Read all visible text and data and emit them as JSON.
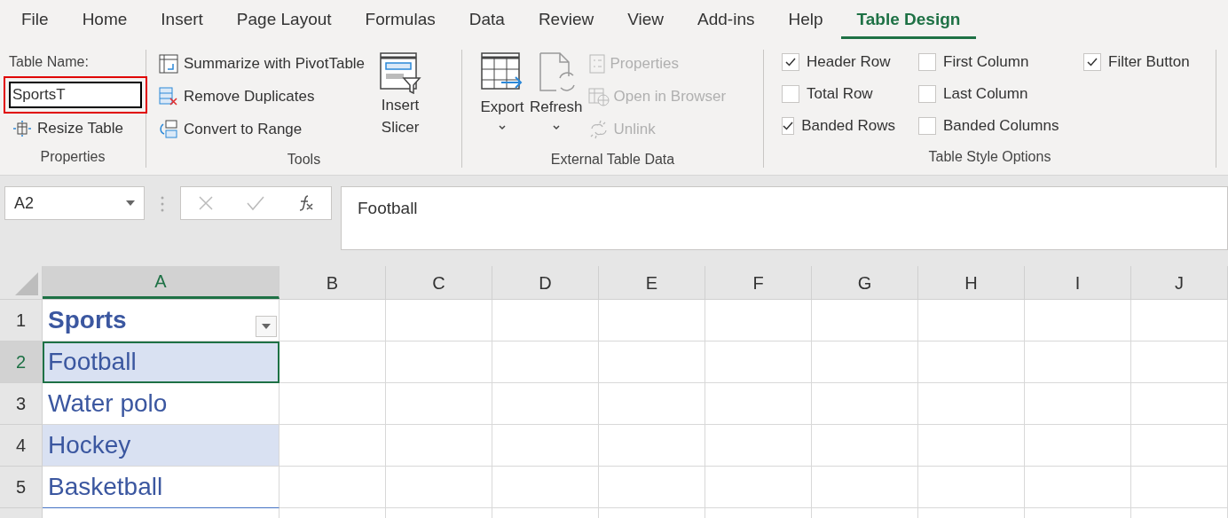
{
  "menu_tabs": [
    {
      "label": "File",
      "selected": false
    },
    {
      "label": "Home",
      "selected": false
    },
    {
      "label": "Insert",
      "selected": false
    },
    {
      "label": "Page Layout",
      "selected": false
    },
    {
      "label": "Formulas",
      "selected": false
    },
    {
      "label": "Data",
      "selected": false
    },
    {
      "label": "Review",
      "selected": false
    },
    {
      "label": "View",
      "selected": false
    },
    {
      "label": "Add-ins",
      "selected": false
    },
    {
      "label": "Help",
      "selected": false
    },
    {
      "label": "Table Design",
      "selected": true
    }
  ],
  "ribbon": {
    "properties": {
      "label": "Table Name:",
      "table_name": "SportsT",
      "highlighted": true,
      "resize": "Resize Table",
      "group": "Properties"
    },
    "tools": {
      "items": [
        {
          "label": "Summarize with PivotTable",
          "kind": "pivot"
        },
        {
          "label": "Remove Duplicates",
          "kind": "dedupe"
        },
        {
          "label": "Convert to Range",
          "kind": "convert"
        }
      ],
      "slicer": "Insert Slicer",
      "group": "Tools"
    },
    "external": {
      "export": "Export",
      "refresh": "Refresh",
      "items": [
        {
          "label": "Properties",
          "disabled": true,
          "kind": "props"
        },
        {
          "label": "Open in Browser",
          "disabled": true,
          "kind": "browser"
        },
        {
          "label": "Unlink",
          "disabled": true,
          "kind": "unlink"
        }
      ],
      "group": "External Table Data"
    },
    "style_options": {
      "columns": [
        [
          {
            "label": "Header Row",
            "checked": true
          },
          {
            "label": "Total Row",
            "checked": false
          },
          {
            "label": "Banded Rows",
            "checked": true
          }
        ],
        [
          {
            "label": "First Column",
            "checked": false
          },
          {
            "label": "Last Column",
            "checked": false
          },
          {
            "label": "Banded Columns",
            "checked": false
          }
        ],
        [
          {
            "label": "Filter Button",
            "checked": true
          }
        ]
      ],
      "group": "Table Style Options"
    }
  },
  "formula_bar": {
    "name_box": "A2",
    "value": "Football"
  },
  "sheet": {
    "columns": [
      {
        "label": "A",
        "selected": true
      },
      {
        "label": "B",
        "selected": false
      },
      {
        "label": "C",
        "selected": false
      },
      {
        "label": "D",
        "selected": false
      },
      {
        "label": "E",
        "selected": false
      },
      {
        "label": "F",
        "selected": false
      },
      {
        "label": "G",
        "selected": false
      },
      {
        "label": "H",
        "selected": false
      },
      {
        "label": "I",
        "selected": false
      },
      {
        "label": "J",
        "selected": false
      }
    ],
    "rows": [
      {
        "number": "1",
        "value": "Sports",
        "kind": "header",
        "shaded": false,
        "selected": false
      },
      {
        "number": "2",
        "value": "Football",
        "kind": "data",
        "shaded": true,
        "selected": true
      },
      {
        "number": "3",
        "value": "Water polo",
        "kind": "data",
        "shaded": false,
        "selected": false
      },
      {
        "number": "4",
        "value": "Hockey",
        "kind": "data",
        "shaded": true,
        "selected": false
      },
      {
        "number": "5",
        "value": "Basketball",
        "kind": "data",
        "shaded": false,
        "selected": false
      }
    ]
  }
}
